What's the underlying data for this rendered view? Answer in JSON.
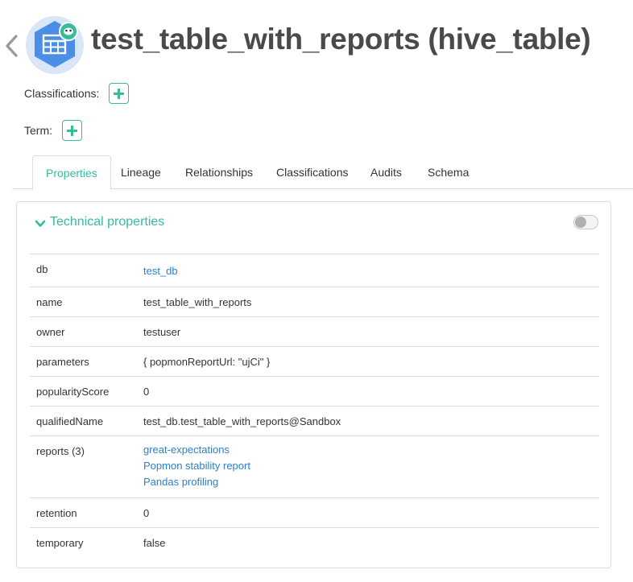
{
  "header": {
    "title": "test_table_with_reports (hive_table)"
  },
  "meta": {
    "classifications_label": "Classifications:",
    "term_label": "Term:"
  },
  "tabs": [
    {
      "label": "Properties",
      "active": true
    },
    {
      "label": "Lineage",
      "active": false
    },
    {
      "label": "Relationships",
      "active": false
    },
    {
      "label": "Classifications",
      "active": false
    },
    {
      "label": "Audits",
      "active": false
    },
    {
      "label": "Schema",
      "active": false
    }
  ],
  "panel": {
    "title": "Technical properties",
    "toggle_on": false
  },
  "properties": [
    {
      "key": "db",
      "value": "test_db",
      "link": true
    },
    {
      "key": "name",
      "value": "test_table_with_reports",
      "link": false
    },
    {
      "key": "owner",
      "value": "testuser",
      "link": false
    },
    {
      "key": "parameters",
      "value": "{ popmonReportUrl: \"ujCi\" }",
      "link": false
    },
    {
      "key": "popularityScore",
      "value": "0",
      "link": false
    },
    {
      "key": "qualifiedName",
      "value": "test_db.test_table_with_reports@Sandbox",
      "link": false
    },
    {
      "key": "reports (3)",
      "values": [
        "great-expectations",
        "Popmon stability report",
        "Pandas profiling"
      ],
      "link": true
    },
    {
      "key": "retention",
      "value": "0",
      "link": false
    },
    {
      "key": "temporary",
      "value": "false",
      "link": false
    }
  ],
  "colors": {
    "accent": "#37bb9b",
    "link": "#2d7fc7",
    "icon_blue": "#4a8ee6"
  }
}
